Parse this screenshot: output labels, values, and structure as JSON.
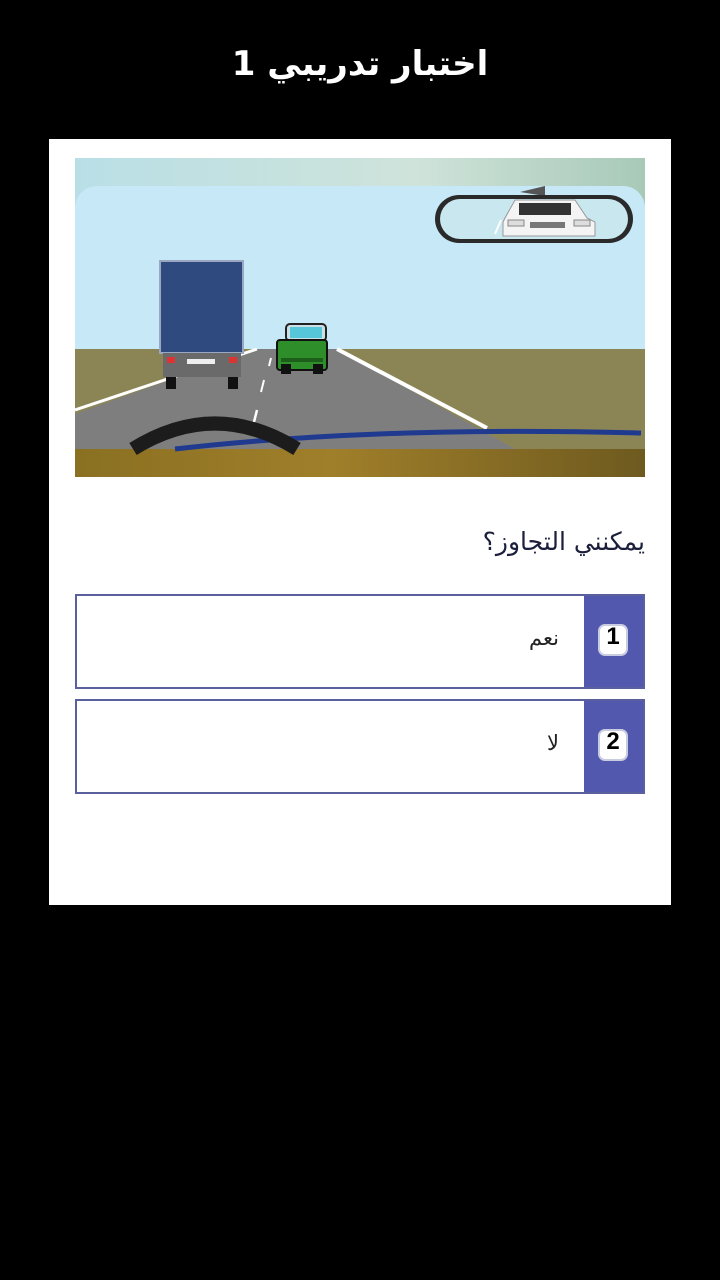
{
  "header": {
    "title": "اختبار تدريبي 1"
  },
  "quiz": {
    "image": {
      "icon": "road-scene-illustration",
      "elements": [
        "truck",
        "green-car",
        "rear-view-mirror",
        "steering-wheel"
      ]
    },
    "question": "يمكنني التجاوز؟",
    "answers": [
      {
        "number": "1",
        "text": "نعم"
      },
      {
        "number": "2",
        "text": "لا"
      }
    ]
  },
  "colors": {
    "background": "#000000",
    "card": "#ffffff",
    "answer_border": "#5a5f9e",
    "answer_number_bg": "#5158ad",
    "sky": "#c7e8f7",
    "grass": "#8b8556",
    "road": "#808080"
  }
}
